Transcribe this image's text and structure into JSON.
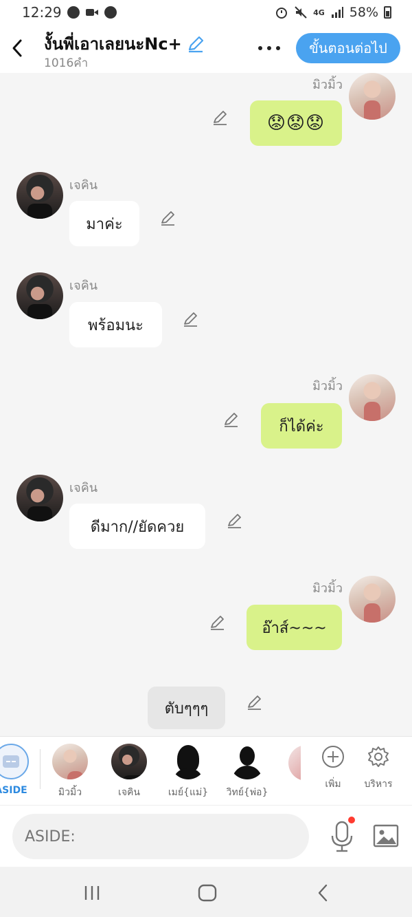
{
  "status_bar": {
    "time": "12:29",
    "battery": "58%",
    "network": "4G"
  },
  "header": {
    "title": "งั้นพี่เอาเลยนะNc+",
    "word_count": "1016คำ",
    "next_button": "ขั้นตอนต่อไป"
  },
  "messages": [
    {
      "side": "right",
      "sender": "มิวมิ้ว",
      "text": "😟😟😟"
    },
    {
      "side": "left",
      "sender": "เจคิน",
      "text": "มาค่ะ"
    },
    {
      "side": "left",
      "sender": "เจคิน",
      "text": "พร้อมนะ"
    },
    {
      "side": "right",
      "sender": "มิวมิ้ว",
      "text": "ก็ได้ค่ะ"
    },
    {
      "side": "left",
      "sender": "เจคิน",
      "text": "ดีมาก//ยัดควย"
    },
    {
      "side": "right",
      "sender": "มิวมิ้ว",
      "text": "อ๊าส์~~~"
    },
    {
      "side": "center",
      "sender": "",
      "text": "ตับๆๆๆ"
    }
  ],
  "characters": [
    {
      "label": "ASIDE"
    },
    {
      "label": "มิวมิ้ว"
    },
    {
      "label": "เจคิน"
    },
    {
      "label": "เมย์{แม่}"
    },
    {
      "label": "วิทย์{พ่อ}"
    }
  ],
  "tools": {
    "add_label": "เพิ่ม",
    "manage_label": "บริหาร"
  },
  "input": {
    "placeholder": "ASIDE:"
  },
  "colors": {
    "accent": "#4aa3f0",
    "right_bubble": "#d9f28a",
    "left_bubble": "#ffffff",
    "narration_bubble": "#e6e6e6"
  }
}
